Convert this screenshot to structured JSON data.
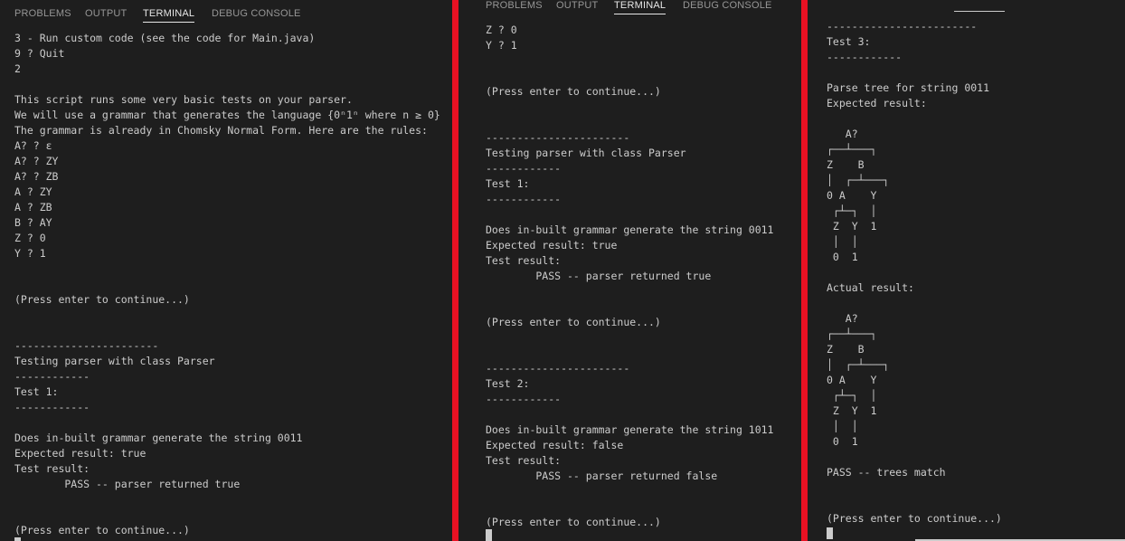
{
  "tabs": {
    "problems": "PROBLEMS",
    "output": "OUTPUT",
    "terminal": "TERMINAL",
    "debug_console": "DEBUG CONSOLE"
  },
  "terminal_left": "3 - Run custom code (see the code for Main.java)\n9 ? Quit\n2\n\nThis script runs some very basic tests on your parser.\nWe will use a grammar that generates the language {0ⁿ1ⁿ where n ≥ 0}\nThe grammar is already in Chomsky Normal Form. Here are the rules:\nA? ? ε\nA? ? ZY\nA? ? ZB\nA ? ZY\nA ? ZB\nB ? AY\nZ ? 0\nY ? 1\n\n\n(Press enter to continue...)\n\n\n-----------------------\nTesting parser with class Parser\n------------\nTest 1:\n------------\n\nDoes in-built grammar generate the string 0011\nExpected result: true\nTest result:\n        PASS -- parser returned true\n\n\n(Press enter to continue...)",
  "terminal_middle": "Z ? 0\nY ? 1\n\n\n(Press enter to continue...)\n\n\n-----------------------\nTesting parser with class Parser\n------------\nTest 1:\n------------\n\nDoes in-built grammar generate the string 0011\nExpected result: true\nTest result:\n        PASS -- parser returned true\n\n\n(Press enter to continue...)\n\n\n-----------------------\nTest 2:\n------------\n\nDoes in-built grammar generate the string 1011\nExpected result: false\nTest result:\n        PASS -- parser returned false\n\n\n(Press enter to continue...)",
  "terminal_right": "------------------------\nTest 3:\n------------\n\nParse tree for string 0011\nExpected result:\n\n   A?\n┌──┴───┐\nZ    B\n│  ┌─┴───┐\n0 A    Y\n ┌┴─┐  │\n Z  Y  1\n │  │\n 0  1\n\nActual result:\n\n   A?\n┌──┴───┐\nZ    B\n│  ┌─┴───┐\n0 A    Y\n ┌┴─┐  │\n Z  Y  1\n │  │\n 0  1\n\nPASS -- trees match\n\n\n(Press enter to continue...)"
}
